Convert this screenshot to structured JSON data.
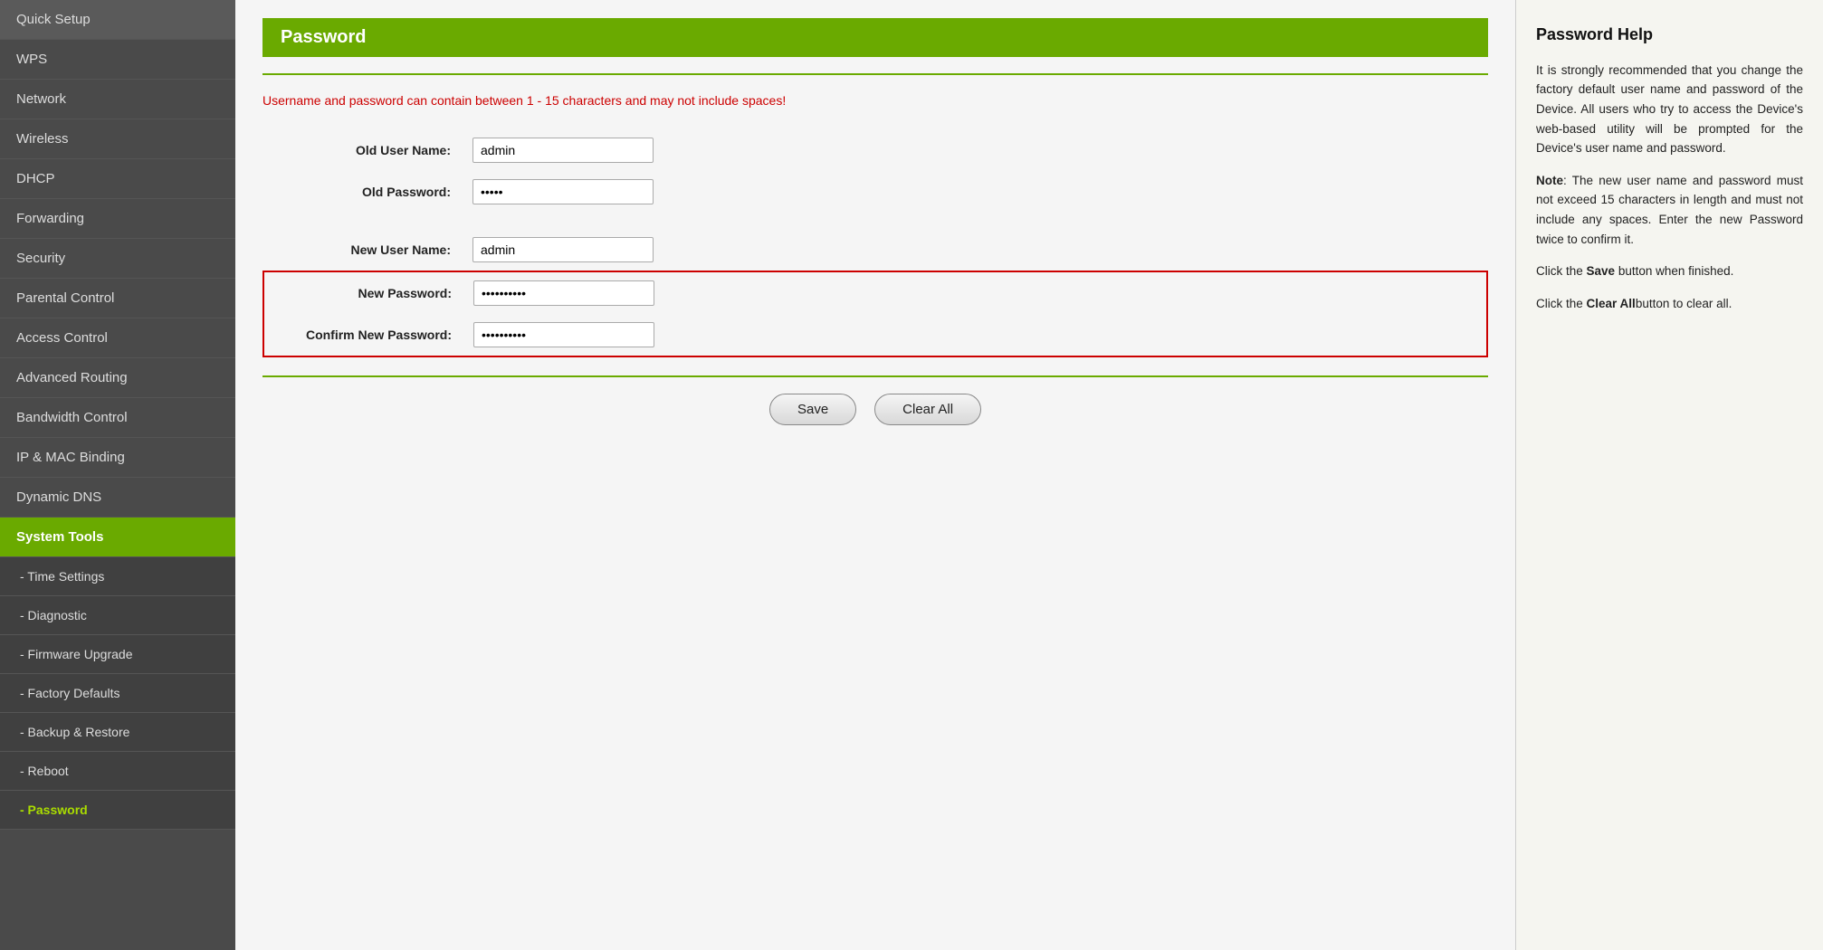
{
  "sidebar": {
    "items": [
      {
        "id": "quick-setup",
        "label": "Quick Setup",
        "active": false,
        "sub": false
      },
      {
        "id": "wps",
        "label": "WPS",
        "active": false,
        "sub": false
      },
      {
        "id": "network",
        "label": "Network",
        "active": false,
        "sub": false
      },
      {
        "id": "wireless",
        "label": "Wireless",
        "active": false,
        "sub": false
      },
      {
        "id": "dhcp",
        "label": "DHCP",
        "active": false,
        "sub": false
      },
      {
        "id": "forwarding",
        "label": "Forwarding",
        "active": false,
        "sub": false
      },
      {
        "id": "security",
        "label": "Security",
        "active": false,
        "sub": false
      },
      {
        "id": "parental-control",
        "label": "Parental Control",
        "active": false,
        "sub": false
      },
      {
        "id": "access-control",
        "label": "Access Control",
        "active": false,
        "sub": false
      },
      {
        "id": "advanced-routing",
        "label": "Advanced Routing",
        "active": false,
        "sub": false
      },
      {
        "id": "bandwidth-control",
        "label": "Bandwidth Control",
        "active": false,
        "sub": false
      },
      {
        "id": "ip-mac-binding",
        "label": "IP & MAC Binding",
        "active": false,
        "sub": false
      },
      {
        "id": "dynamic-dns",
        "label": "Dynamic DNS",
        "active": false,
        "sub": false
      },
      {
        "id": "system-tools",
        "label": "System Tools",
        "active": true,
        "sub": false
      },
      {
        "id": "time-settings",
        "label": "- Time Settings",
        "active": false,
        "sub": true
      },
      {
        "id": "diagnostic",
        "label": "- Diagnostic",
        "active": false,
        "sub": true
      },
      {
        "id": "firmware-upgrade",
        "label": "- Firmware Upgrade",
        "active": false,
        "sub": true
      },
      {
        "id": "factory-defaults",
        "label": "- Factory Defaults",
        "active": false,
        "sub": true
      },
      {
        "id": "backup-restore",
        "label": "- Backup & Restore",
        "active": false,
        "sub": true
      },
      {
        "id": "reboot",
        "label": "- Reboot",
        "active": false,
        "sub": true
      },
      {
        "id": "password",
        "label": "- Password",
        "active": false,
        "sub": true,
        "subActive": true
      }
    ]
  },
  "page": {
    "title": "Password",
    "warning": "Username and password can contain between 1 - 15 characters and may not include spaces!"
  },
  "form": {
    "old_username_label": "Old User Name:",
    "old_username_value": "admin",
    "old_password_label": "Old Password:",
    "old_password_value": "•••••",
    "new_username_label": "New User Name:",
    "new_username_value": "admin",
    "new_password_label": "New Password:",
    "new_password_value": "••••••••••",
    "confirm_password_label": "Confirm New Password:",
    "confirm_password_value": "••••••••••"
  },
  "buttons": {
    "save": "Save",
    "clear_all": "Clear All"
  },
  "help": {
    "title": "Password Help",
    "para1": "It is strongly recommended that you change the factory default user name and password of the Device. All users who try to access the Device's web-based utility will be prompted for the Device's user name and password.",
    "note_label": "Note",
    "note_text": ": The new user name and password must not exceed 15 characters in length and must not include any spaces. Enter the new Password twice to confirm it.",
    "save_instruction": "Click the ",
    "save_label": "Save",
    "save_instruction2": " button when finished.",
    "clear_instruction": "Click the ",
    "clear_label": "Clear All",
    "clear_instruction2": "button to clear all."
  }
}
